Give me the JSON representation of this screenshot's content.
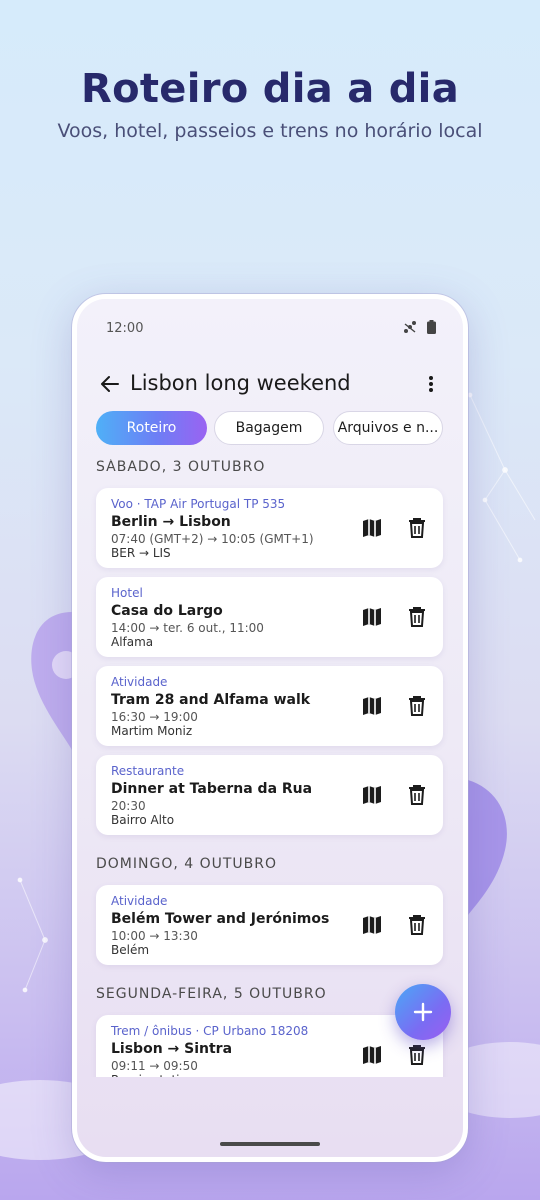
{
  "hero": {
    "title": "Roteiro dia a dia",
    "subtitle": "Voos, hotel, passeios e trens no horário local"
  },
  "status_bar": {
    "time": "12:00",
    "icons": [
      "signal-icon",
      "battery-icon"
    ]
  },
  "app_bar": {
    "title": "Lisbon long weekend",
    "back_icon": "arrow-back-icon",
    "more_icon": "more-vert-icon"
  },
  "tabs": [
    {
      "label": "Roteiro",
      "active": true
    },
    {
      "label": "Bagagem",
      "active": false
    },
    {
      "label": "Arquivos e n...",
      "active": false
    }
  ],
  "days": [
    {
      "header": "SÁBADO, 3 OUTUBRO",
      "items": [
        {
          "category": "Voo · TAP Air Portugal TP 535",
          "title": "Berlin → Lisbon",
          "time": "07:40 (GMT+2) → 10:05 (GMT+1)",
          "location": "BER → LIS"
        },
        {
          "category": "Hotel",
          "title": "Casa do Largo",
          "time": "14:00 → ter. 6 out., 11:00",
          "location": "Alfama"
        },
        {
          "category": "Atividade",
          "title": "Tram 28 and Alfama walk",
          "time": "16:30 → 19:00",
          "location": "Martim Moniz"
        },
        {
          "category": "Restaurante",
          "title": "Dinner at Taberna da Rua",
          "time": "20:30",
          "location": "Bairro Alto"
        }
      ]
    },
    {
      "header": "DOMINGO, 4 OUTUBRO",
      "items": [
        {
          "category": "Atividade",
          "title": "Belém Tower and Jerónimos",
          "time": "10:00 → 13:30",
          "location": "Belém"
        }
      ]
    },
    {
      "header": "SEGUNDA-FEIRA, 5 OUTUBRO",
      "items": [
        {
          "category": "Trem / ônibus · CP Urbano 18208",
          "title": "Lisbon → Sintra",
          "time": "09:11 → 09:50",
          "location": "Rossio station"
        }
      ]
    }
  ],
  "item_icons": {
    "map": "map-icon",
    "delete": "trash-icon"
  },
  "fab": {
    "icon": "plus-icon"
  },
  "colors": {
    "title": "#27296b",
    "category": "#5a63cc",
    "accent_start": "#4fb0f7",
    "accent_end": "#9a63f2"
  }
}
